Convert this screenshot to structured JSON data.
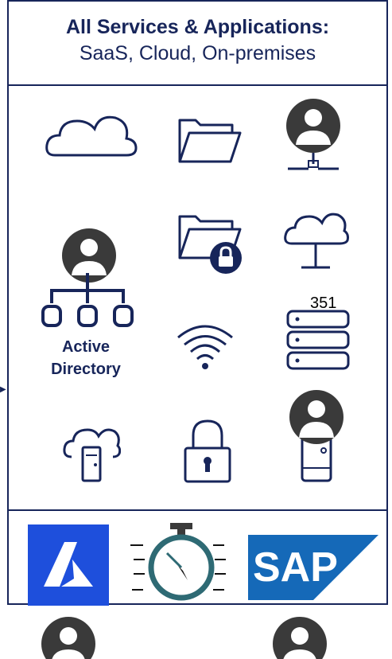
{
  "header": {
    "title": "All Services & Applications:",
    "subtitle": "SaaS, Cloud, On-premises"
  },
  "active_directory": {
    "line1": "Active",
    "line2": "Directory"
  },
  "server_count": "351",
  "logos": {
    "sap_text": "SAP",
    "sap_registered": "®"
  },
  "colors": {
    "navy": "#17255a",
    "azure_blue": "#1e4fdc",
    "sap_blue": "#1569b8",
    "avatar_gray": "#3a3a3a",
    "stopwatch_teal": "#2e6a74"
  }
}
